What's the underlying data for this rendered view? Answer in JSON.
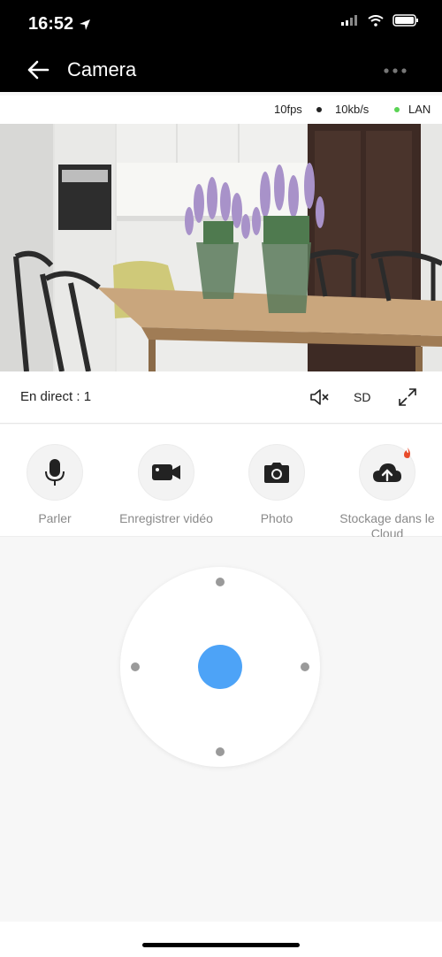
{
  "status": {
    "time": "16:52"
  },
  "nav": {
    "title": "Camera"
  },
  "stream": {
    "fps": "10fps",
    "bitrate": "10kb/s",
    "connection": "LAN",
    "connection_color": "#5ad354"
  },
  "live": {
    "label": "En direct : 1",
    "quality": "SD"
  },
  "actions": [
    {
      "label": "Parler",
      "icon": "microphone-icon"
    },
    {
      "label": "Enregistrer vidéo",
      "icon": "video-camera-icon"
    },
    {
      "label": "Photo",
      "icon": "photo-camera-icon"
    },
    {
      "label": "Stockage dans le Cloud",
      "icon": "cloud-upload-icon"
    }
  ],
  "colors": {
    "accent": "#4da3f7",
    "header_bg": "#000000"
  }
}
